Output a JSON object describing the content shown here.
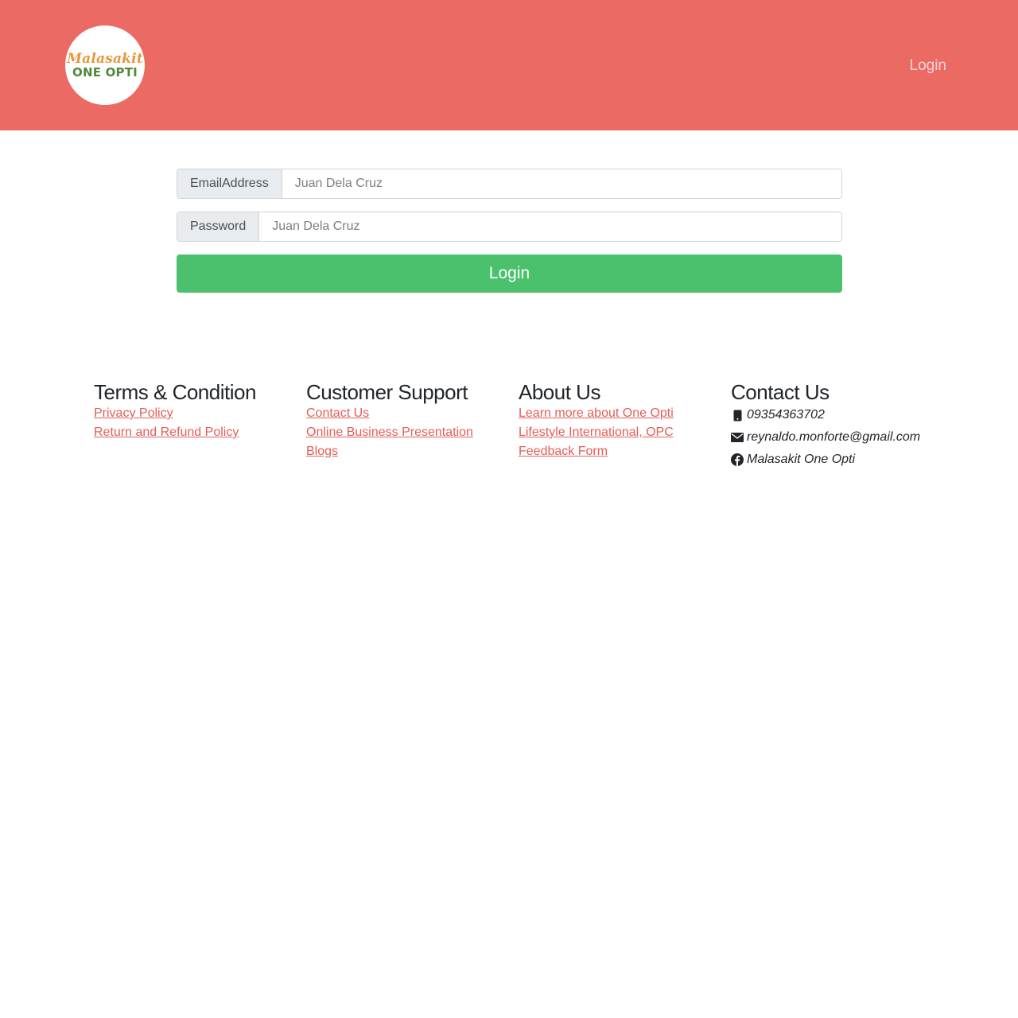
{
  "header": {
    "logo": {
      "line1": "Malasakit",
      "line2": "ONE OPTI"
    },
    "nav_login": "Login"
  },
  "form": {
    "email_label": "EmailAddress",
    "email_placeholder": "Juan Dela Cruz",
    "password_label": "Password",
    "password_placeholder": "Juan Dela Cruz",
    "submit_label": "Login"
  },
  "footer": {
    "terms": {
      "title": "Terms & Condition",
      "links": [
        "Privacy Policy",
        "Return and Refund Policy"
      ]
    },
    "support": {
      "title": "Customer Support",
      "links": [
        "Contact Us",
        "Online Business Presentation",
        "Blogs"
      ]
    },
    "about": {
      "title": "About Us",
      "links": [
        "Learn more about One Opti",
        "Lifestyle International, OPC",
        "Feedback Form"
      ]
    },
    "contact": {
      "title": "Contact Us",
      "phone": "09354363702",
      "email": "reynaldo.monforte@gmail.com",
      "facebook": "Malasakit One Opti"
    }
  },
  "colors": {
    "header_bg": "#ec6a64",
    "button_green": "#4cc16d",
    "link_red": "#e25e58"
  }
}
